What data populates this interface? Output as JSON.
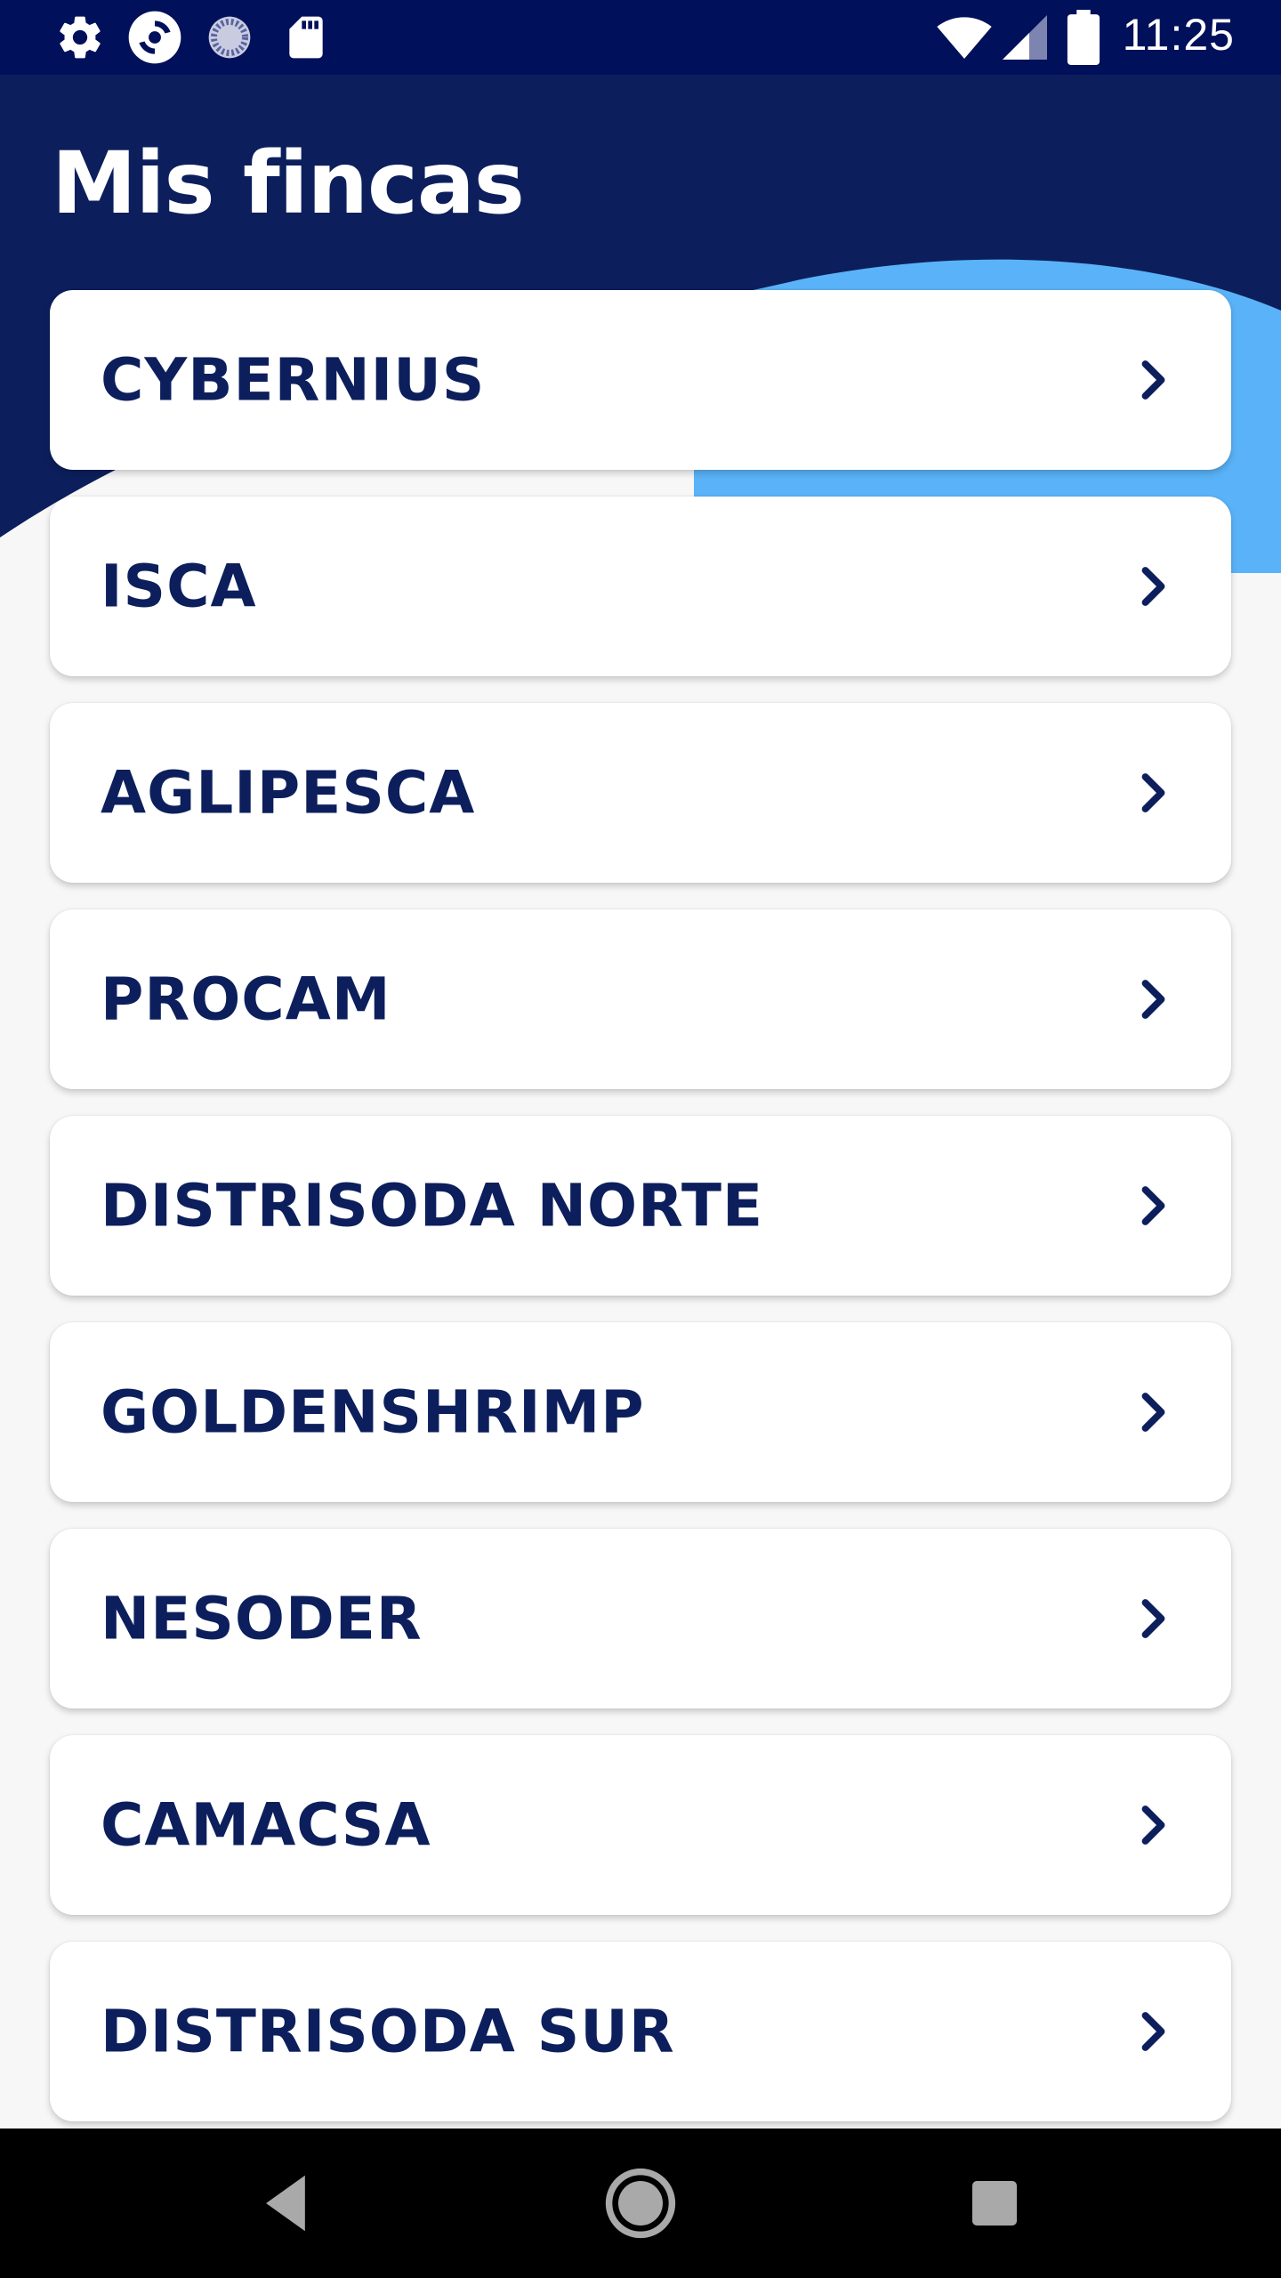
{
  "status_bar": {
    "time": "11:25",
    "left_icons": [
      "settings-icon",
      "sync-app-icon",
      "loading-icon",
      "sd-card-icon"
    ],
    "right_icons": [
      "wifi-icon",
      "cell-signal-icon",
      "battery-icon"
    ]
  },
  "page": {
    "title": "Mis fincas"
  },
  "farms": [
    {
      "name": "CYBERNIUS"
    },
    {
      "name": "ISCA"
    },
    {
      "name": "AGLIPESCA"
    },
    {
      "name": "PROCAM"
    },
    {
      "name": "DISTRISODA NORTE"
    },
    {
      "name": "GOLDENSHRIMP"
    },
    {
      "name": "NESODER"
    },
    {
      "name": "CAMACSA"
    },
    {
      "name": "DISTRISODA SUR"
    }
  ],
  "nav_bar": {
    "buttons": [
      "back-icon",
      "home-icon",
      "recents-icon"
    ]
  },
  "colors": {
    "header": "#0c1f5c",
    "status_bar": "#00105a",
    "accent_wave": "#5ab3f8",
    "card_text": "#0c1f5c",
    "background": "#f7f7f8"
  }
}
